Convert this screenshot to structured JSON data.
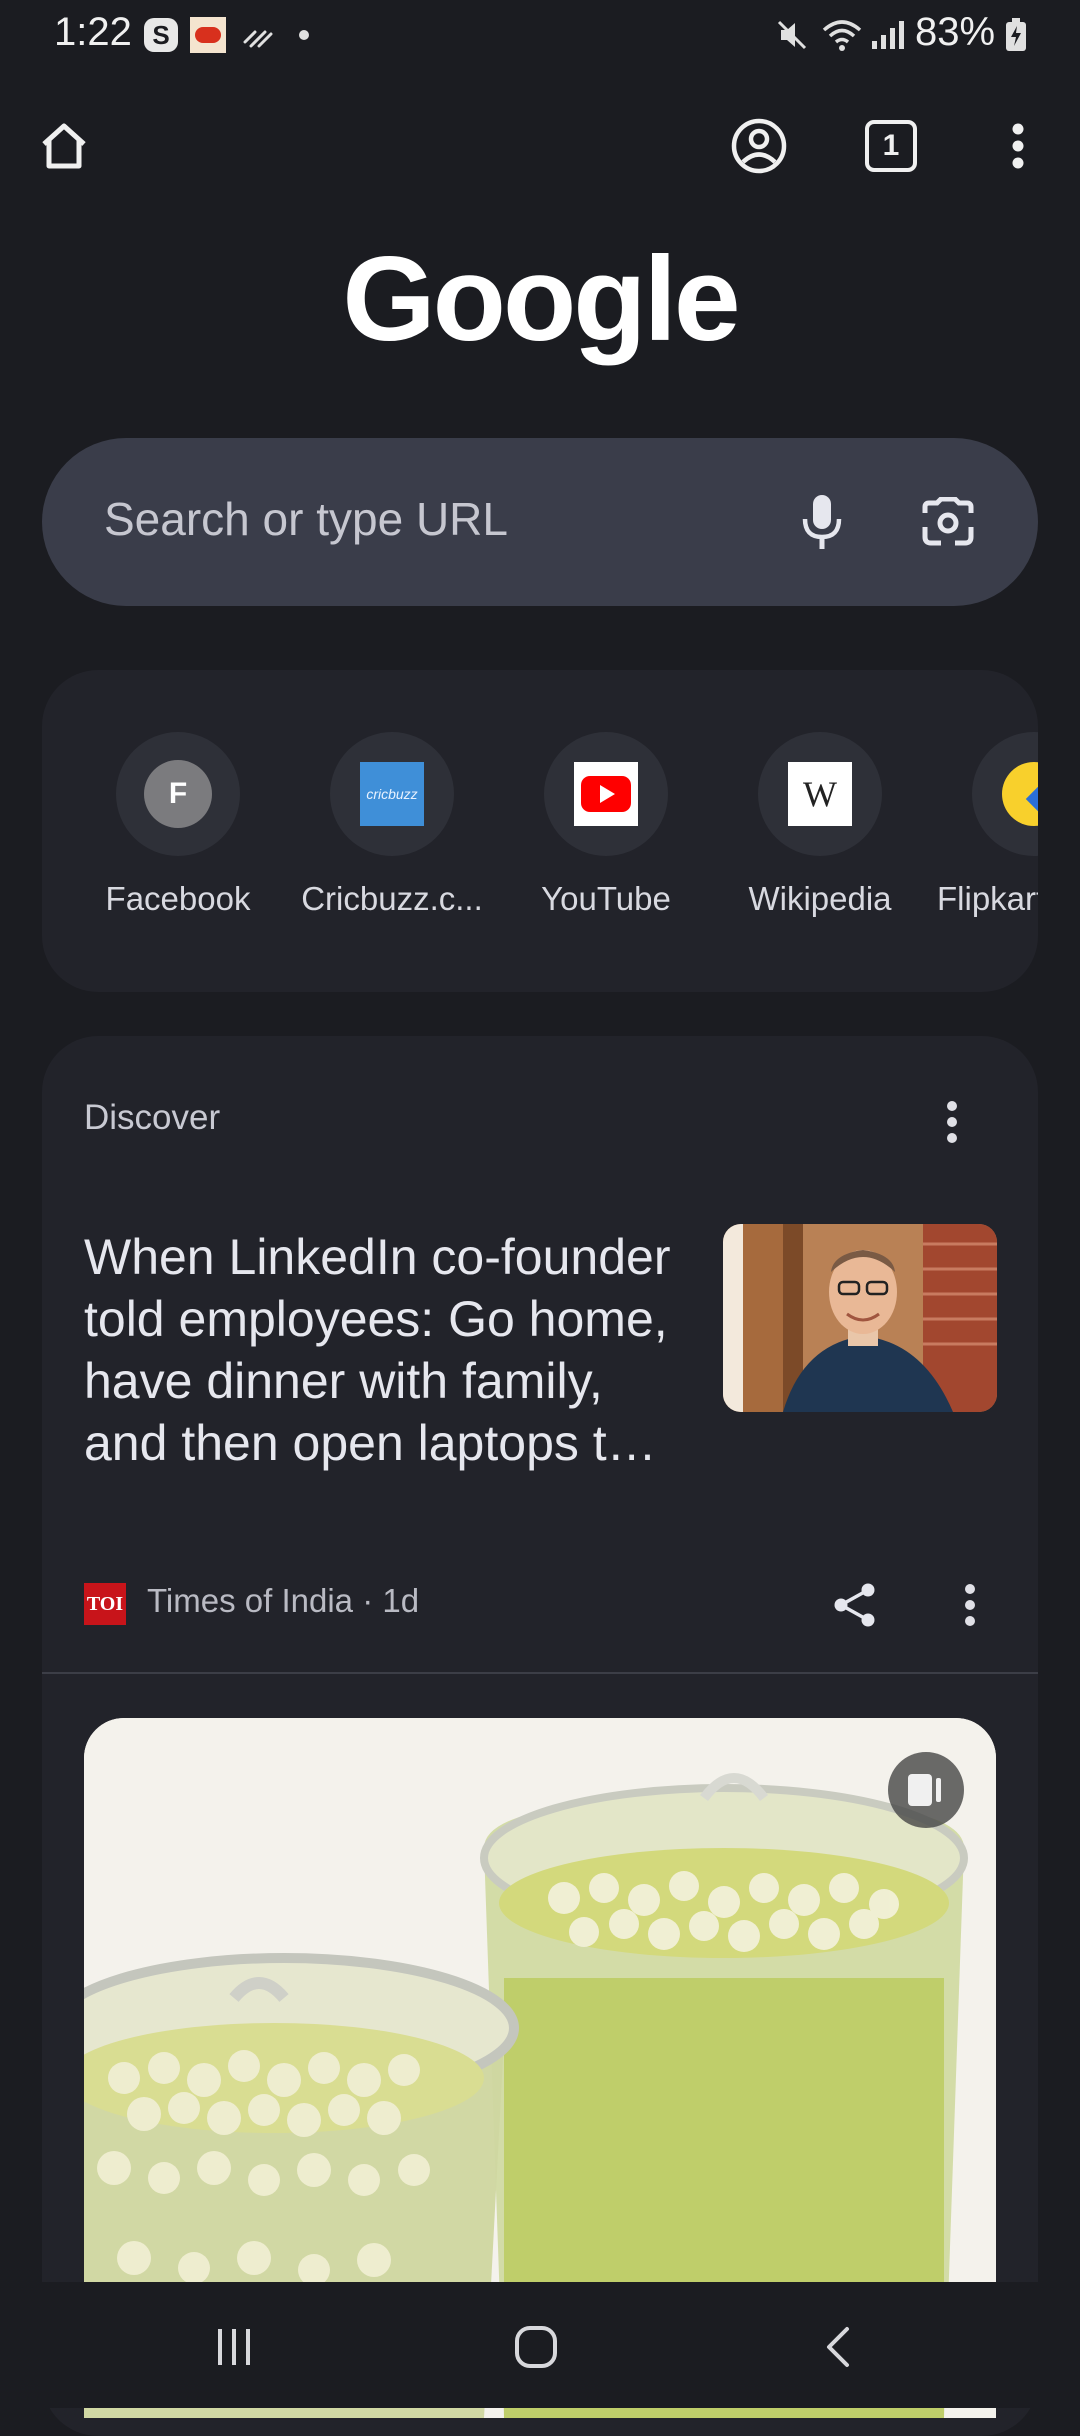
{
  "status_bar": {
    "time": "1:22",
    "battery": "83%",
    "icons": [
      "s-app-icon",
      "news-app-icon",
      "diagonal-lines-icon",
      "dot-icon",
      "mute-icon",
      "wifi-icon",
      "signal-icon",
      "battery-icon"
    ]
  },
  "toolbar": {
    "home": "home-icon",
    "account": "account-icon",
    "tab_count": "1",
    "menu": "more-vert-icon"
  },
  "logo": "Google",
  "search": {
    "placeholder": "Search or type URL"
  },
  "shortcuts": [
    {
      "label": "Facebook",
      "letter": "F"
    },
    {
      "label": "Cricbuzz.c...",
      "letter": "cricbuzz"
    },
    {
      "label": "YouTube"
    },
    {
      "label": "Wikipedia",
      "letter": "W"
    },
    {
      "label": "Flipkart"
    }
  ],
  "discover": {
    "title": "Discover",
    "article": {
      "headline": "When LinkedIn co-founder told employees: Go home, have dinner with family, and then open laptops t…",
      "source_logo": "TOI",
      "source": "Times of India · 1d"
    }
  },
  "colors": {
    "background": "#1b1c21",
    "card": "#22232a",
    "search": "#3a3d4a",
    "youtube_red": "#ff0000",
    "toi_red": "#c8141a"
  }
}
